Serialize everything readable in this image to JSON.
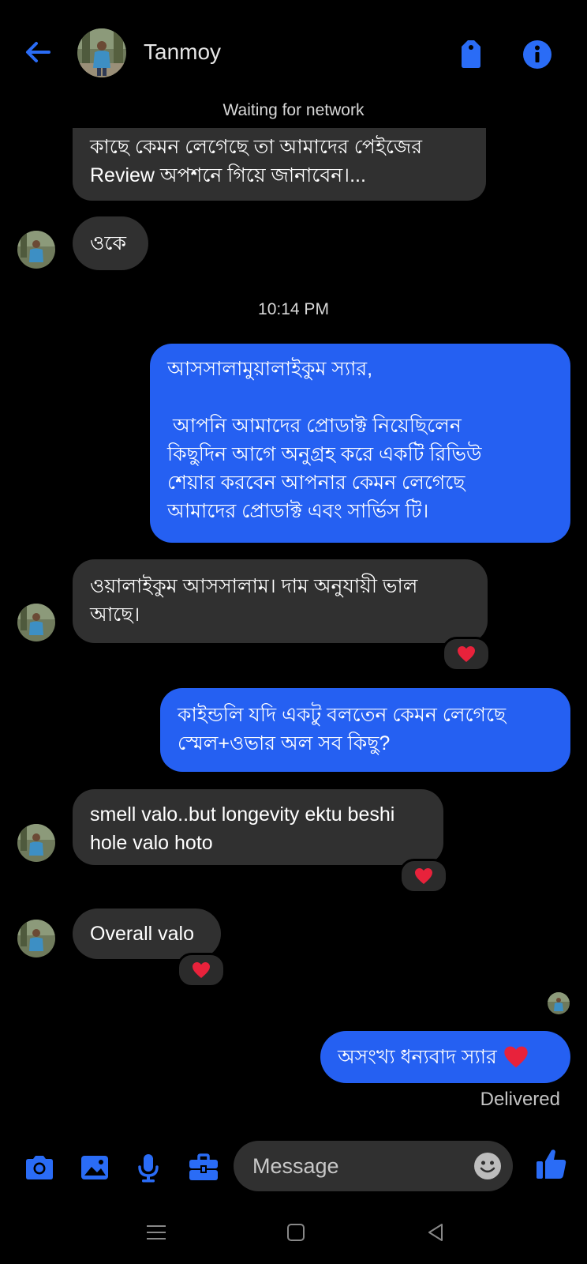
{
  "header": {
    "contact_name": "Tanmoy",
    "network_status": "Waiting for network"
  },
  "conversation": {
    "timestamp": "10:14 PM",
    "messages": [
      {
        "from": "them",
        "text": "আমাদের প্রোডাক্ট এবং সার্ভিস আপনার\nকাছে কেমন লেগেছে তা আমাদের পেইজের\nReview অপশনে গিয়ে জানাবেন।..."
      },
      {
        "from": "them",
        "text": "ওকে"
      },
      {
        "from": "me",
        "text": "আসসালামুয়ালাইকুম স্যার,\n\n আপনি আমাদের প্রোডাক্ট নিয়েছিলেন\nকিছুদিন আগে অনুগ্রহ করে একটি রিভিউ\nশেয়ার করবেন আপনার কেমন লেগেছে\nআমাদের প্রোডাক্ট এবং সার্ভিস টি।"
      },
      {
        "from": "them",
        "text": "ওয়ালাইকুম আসসালাম। দাম অনুযায়ী ভাল\nআছে।",
        "reaction": "heart"
      },
      {
        "from": "me",
        "text": "কাইন্ডলি যদি একটু বলতেন কেমন লেগেছে\nস্মেল+ওভার অল সব কিছু?"
      },
      {
        "from": "them",
        "text": "smell valo..but longevity ektu beshi\nhole valo hoto",
        "reaction": "heart"
      },
      {
        "from": "them",
        "text": "Overall valo",
        "reaction": "heart"
      },
      {
        "from": "me",
        "text": "অসংখ্য ধন্যবাদ স্যার",
        "emoji": "red-heart"
      }
    ],
    "delivery_status": "Delivered"
  },
  "composer": {
    "placeholder": "Message"
  },
  "colors": {
    "accent": "#2a6cf6",
    "outgoing_bubble": "#2560f2",
    "incoming_bubble": "#303030",
    "reaction_heart": "#e8223b"
  }
}
